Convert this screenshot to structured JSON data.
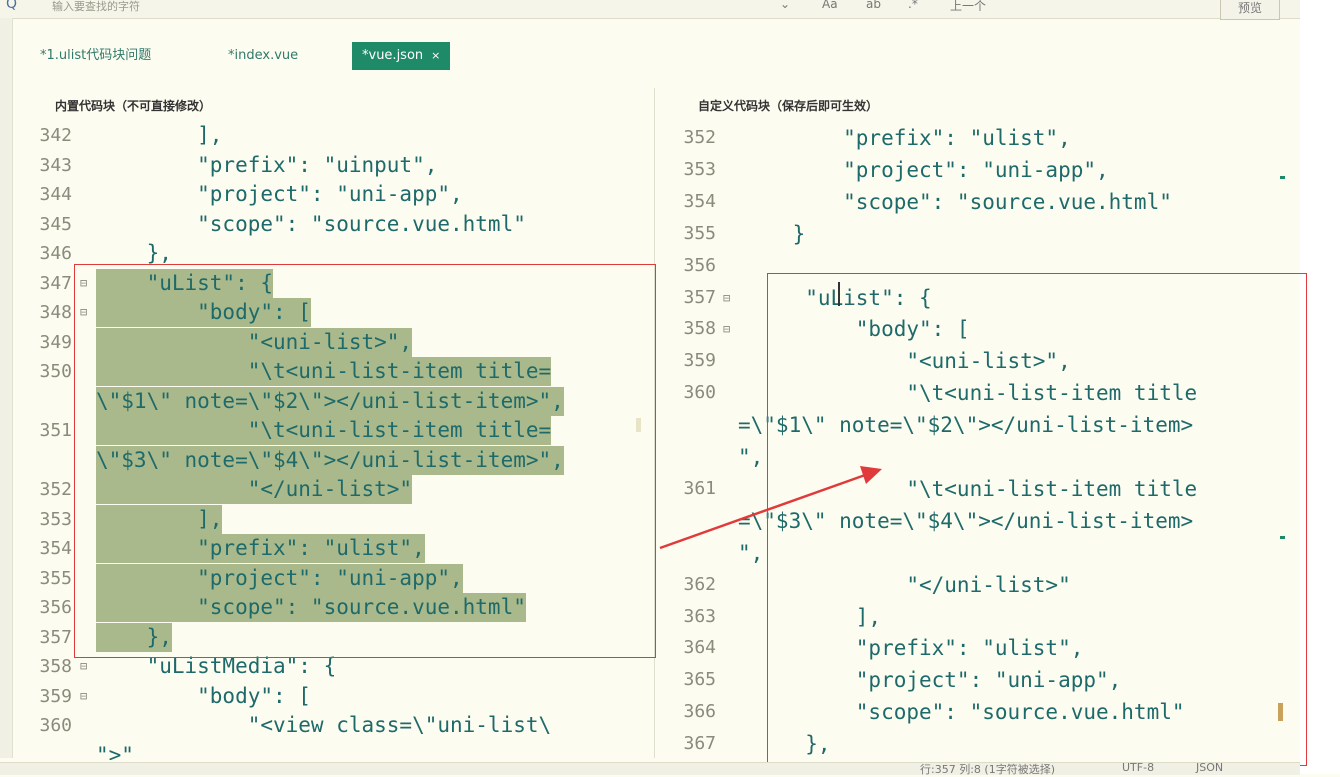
{
  "toolbar": {
    "search_placeholder": "输入要查找的字符",
    "prev_label": "上一个",
    "preview_label": "预览"
  },
  "tabs": [
    {
      "label": "*1.ulist代码块问题",
      "active": false
    },
    {
      "label": "*index.vue",
      "active": false
    },
    {
      "label": "*vue.json",
      "active": true,
      "close": "×"
    }
  ],
  "left_panel": {
    "title": "内置代码块（不可直接修改）",
    "lines": [
      {
        "num": "342",
        "text": "        ],"
      },
      {
        "num": "343",
        "text": "        \"prefix\": \"uinput\","
      },
      {
        "num": "344",
        "text": "        \"project\": \"uni-app\","
      },
      {
        "num": "345",
        "text": "        \"scope\": \"source.vue.html\""
      },
      {
        "num": "346",
        "text": "    },"
      },
      {
        "num": "347",
        "text": "    \"uList\": {",
        "fold": true
      },
      {
        "num": "348",
        "text": "        \"body\": [",
        "fold": true
      },
      {
        "num": "349",
        "text": "            \"<uni-list>\","
      },
      {
        "num": "350",
        "text": "            \"\\t<uni-list-item title="
      },
      {
        "num": "",
        "text": "\\\"$1\\\" note=\\\"$2\\\"></uni-list-item>\","
      },
      {
        "num": "351",
        "text": "            \"\\t<uni-list-item title="
      },
      {
        "num": "",
        "text": "\\\"$3\\\" note=\\\"$4\\\"></uni-list-item>\","
      },
      {
        "num": "352",
        "text": "            \"</uni-list>\""
      },
      {
        "num": "353",
        "text": "        ],"
      },
      {
        "num": "354",
        "text": "        \"prefix\": \"ulist\","
      },
      {
        "num": "355",
        "text": "        \"project\": \"uni-app\","
      },
      {
        "num": "356",
        "text": "        \"scope\": \"source.vue.html\""
      },
      {
        "num": "357",
        "text": "    },"
      },
      {
        "num": "358",
        "text": "    \"uListMedia\": {",
        "fold": true
      },
      {
        "num": "359",
        "text": "        \"body\": [",
        "fold": true
      },
      {
        "num": "360",
        "text": "            \"<view class=\\\"uni-list\\"
      },
      {
        "num": "",
        "text": "\">\""
      }
    ]
  },
  "right_panel": {
    "title": "自定义代码块（保存后即可生效）",
    "lines": [
      {
        "num": "352",
        "text": "        \"prefix\": \"ulist\","
      },
      {
        "num": "353",
        "text": "        \"project\": \"uni-app\","
      },
      {
        "num": "354",
        "text": "        \"scope\": \"source.vue.html\""
      },
      {
        "num": "355",
        "text": "    }"
      },
      {
        "num": "356",
        "text": ""
      },
      {
        "num": "357",
        "text": "     \"uList\": {",
        "fold": true
      },
      {
        "num": "358",
        "text": "         \"body\": [",
        "fold": true
      },
      {
        "num": "359",
        "text": "             \"<uni-list>\","
      },
      {
        "num": "360",
        "text": "             \"\\t<uni-list-item title"
      },
      {
        "num": "",
        "text": "=\\\"$1\\\" note=\\\"$2\\\"></uni-list-item>"
      },
      {
        "num": "",
        "text": "\","
      },
      {
        "num": "361",
        "text": "             \"\\t<uni-list-item title"
      },
      {
        "num": "",
        "text": "=\\\"$3\\\" note=\\\"$4\\\"></uni-list-item>"
      },
      {
        "num": "",
        "text": "\","
      },
      {
        "num": "362",
        "text": "             \"</uni-list>\""
      },
      {
        "num": "363",
        "text": "         ],"
      },
      {
        "num": "364",
        "text": "         \"prefix\": \"ulist\","
      },
      {
        "num": "365",
        "text": "         \"project\": \"uni-app\","
      },
      {
        "num": "366",
        "text": "         \"scope\": \"source.vue.html\""
      },
      {
        "num": "367",
        "text": "     },"
      }
    ]
  },
  "status": {
    "position": "行:357  列:8 (1字符被选择)",
    "encoding": "UTF-8",
    "language": "JSON"
  },
  "colors": {
    "accent": "#1f8a68",
    "highlight": "#aab98b",
    "annotation_red": "#e03a3a",
    "code_text": "#1e6a6a"
  }
}
